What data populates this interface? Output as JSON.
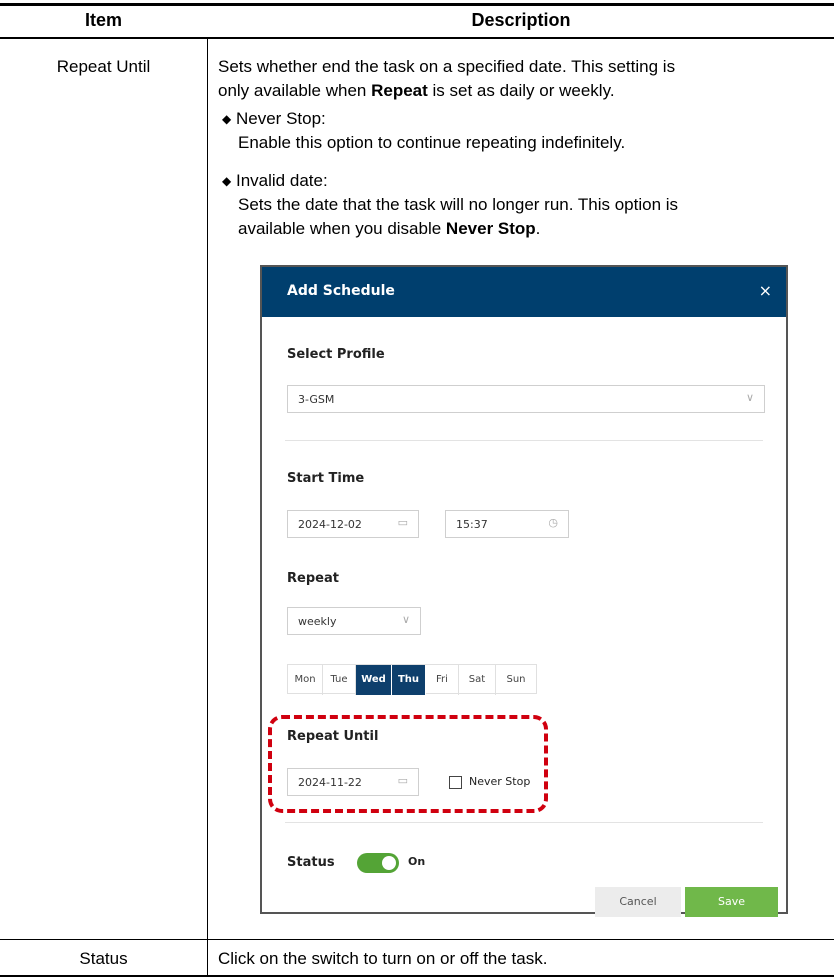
{
  "table": {
    "header_item": "Item",
    "header_description": "Description",
    "rows": [
      {
        "item": "Repeat Until",
        "desc_line1": "Sets whether end the task on a specified date. This setting is",
        "desc_line2_pre": "only available when ",
        "desc_line2_bold": "Repeat",
        "desc_line2_post": " is set as daily or weekly.",
        "bullet1_head": "Never Stop:",
        "bullet1_body": "Enable this option to continue repeating indefinitely.",
        "bullet2_head": "Invalid date:",
        "bullet2_body_line1": "Sets the date that the task will no longer run. This option is",
        "bullet2_body_pre": "available when you disable ",
        "bullet2_body_bold": "Never Stop",
        "bullet2_body_post": "."
      },
      {
        "item": "Status",
        "description": "Click on the switch to turn on or off the task."
      }
    ]
  },
  "dialog": {
    "title": "Add Schedule",
    "close": "×",
    "select_profile_label": "Select Profile",
    "profile_value": "3-GSM",
    "start_time_label": "Start Time",
    "start_date": "2024-12-02",
    "start_time": "15:37",
    "repeat_label": "Repeat",
    "repeat_value": "weekly",
    "days": [
      {
        "label": "Mon",
        "selected": false
      },
      {
        "label": "Tue",
        "selected": false
      },
      {
        "label": "Wed",
        "selected": true
      },
      {
        "label": "Thu",
        "selected": true
      },
      {
        "label": "Fri",
        "selected": false
      },
      {
        "label": "Sat",
        "selected": false
      },
      {
        "label": "Sun",
        "selected": false
      }
    ],
    "repeat_until_label": "Repeat Until",
    "repeat_until_date": "2024-11-22",
    "never_stop_label": "Never Stop",
    "never_stop_checked": false,
    "status_label": "Status",
    "status_value": "On",
    "status_on": true,
    "cancel_label": "Cancel",
    "save_label": "Save"
  },
  "colors": {
    "header_bg": "#003f6e",
    "day_selected_bg": "#0e3f6c",
    "toggle_on": "#54a436",
    "save_button": "#70b84a",
    "highlight": "#d0000f"
  },
  "icons": {
    "bullet": "diamond-bullet-icon",
    "calendar": "calendar-icon",
    "clock": "clock-icon",
    "chevron": "chevron-down-icon",
    "close": "close-icon"
  }
}
